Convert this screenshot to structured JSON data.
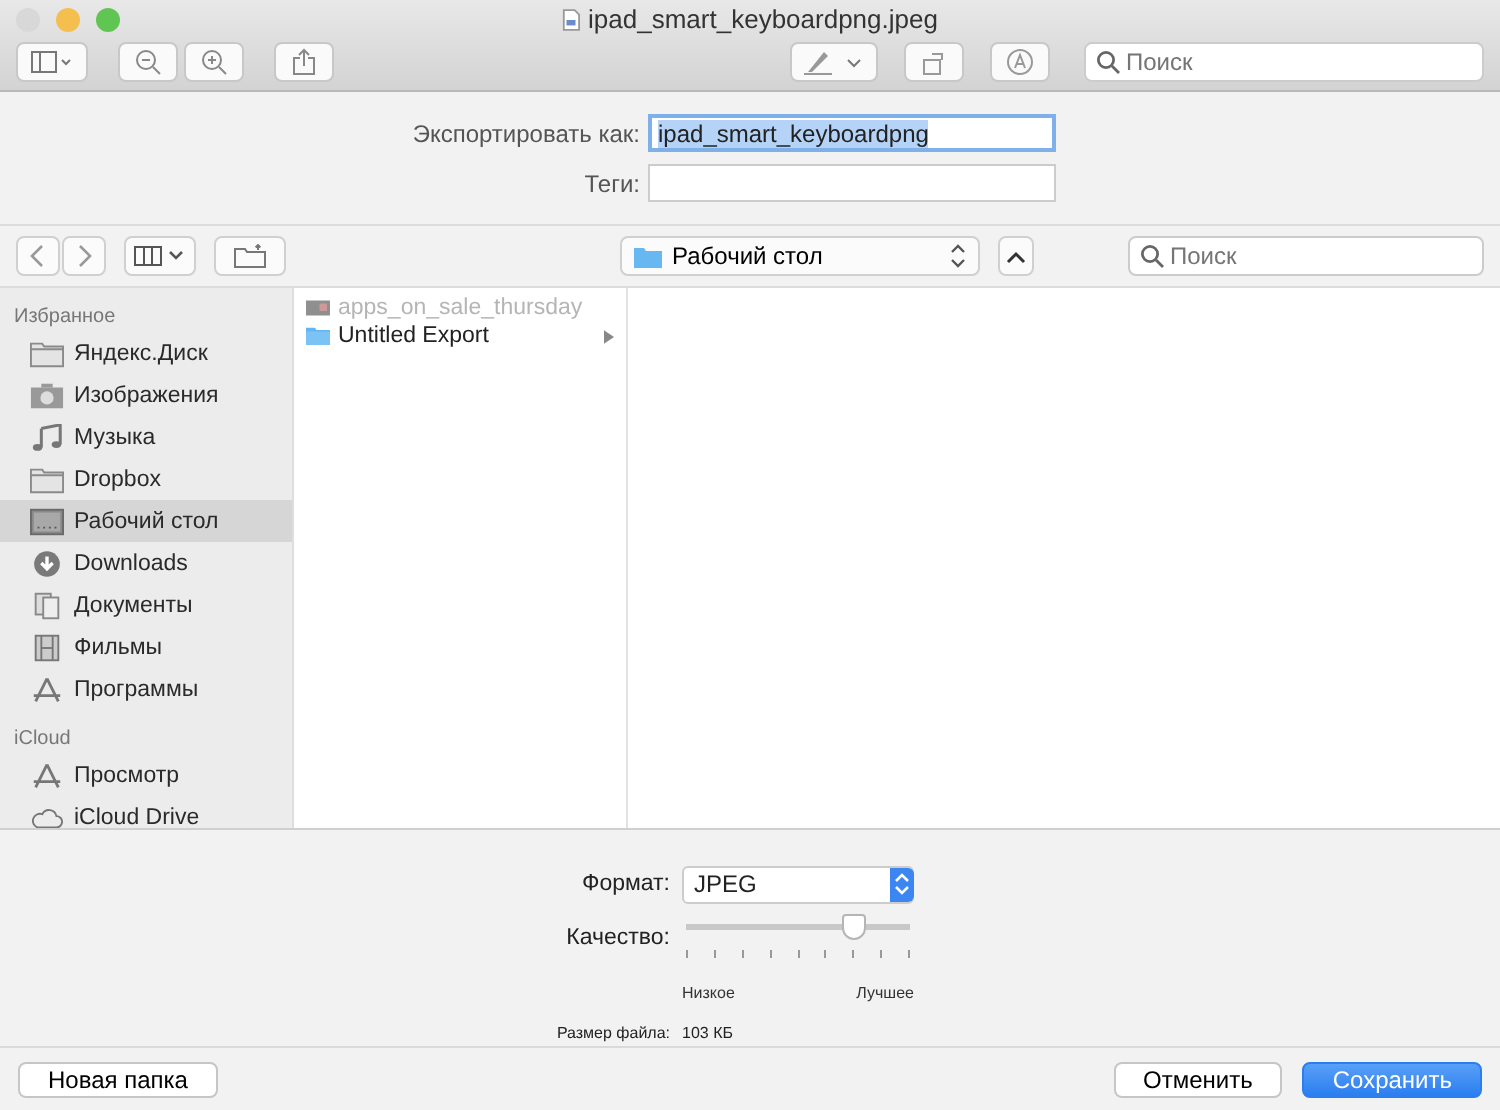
{
  "window": {
    "title": "ipad_smart_keyboardpng.jpeg"
  },
  "toolbar": {
    "search": {
      "placeholder": "Поиск"
    }
  },
  "export": {
    "name_label": "Экспортировать как:",
    "name_value": "ipad_smart_keyboardpng",
    "tags_label": "Теги:"
  },
  "navigation": {
    "location": "Рабочий стол",
    "search": {
      "placeholder": "Поиск"
    }
  },
  "sidebar": {
    "sections": [
      {
        "title": "Избранное",
        "items": [
          {
            "label": "Яндекс.Диск",
            "kind": "folder",
            "selected": false
          },
          {
            "label": "Изображения",
            "kind": "camera",
            "selected": false
          },
          {
            "label": "Музыка",
            "kind": "music",
            "selected": false
          },
          {
            "label": "Dropbox",
            "kind": "folder",
            "selected": false
          },
          {
            "label": "Рабочий стол",
            "kind": "desktop",
            "selected": true
          },
          {
            "label": "Downloads",
            "kind": "download",
            "selected": false
          },
          {
            "label": "Документы",
            "kind": "documents",
            "selected": false
          },
          {
            "label": "Фильмы",
            "kind": "film",
            "selected": false
          },
          {
            "label": "Программы",
            "kind": "apps",
            "selected": false
          }
        ]
      },
      {
        "title": "iCloud",
        "items": [
          {
            "label": "Просмотр",
            "kind": "apps",
            "selected": false
          },
          {
            "label": "iCloud Drive",
            "kind": "cloud",
            "selected": false
          }
        ]
      }
    ]
  },
  "files": [
    {
      "name": "apps_on_sale_thursday",
      "kind": "image",
      "disabled": true
    },
    {
      "name": "Untitled Export",
      "kind": "folder",
      "disabled": false
    }
  ],
  "options": {
    "format_label": "Формат:",
    "format_value": "JPEG",
    "quality_label": "Качество:",
    "quality": {
      "level": 0.75
    },
    "low_label": "Низкое",
    "high_label": "Лучшее",
    "size_label": "Размер файла:",
    "size_value": "103 КБ"
  },
  "buttons": {
    "new_folder": "Новая папка",
    "cancel": "Отменить",
    "save": "Сохранить"
  }
}
